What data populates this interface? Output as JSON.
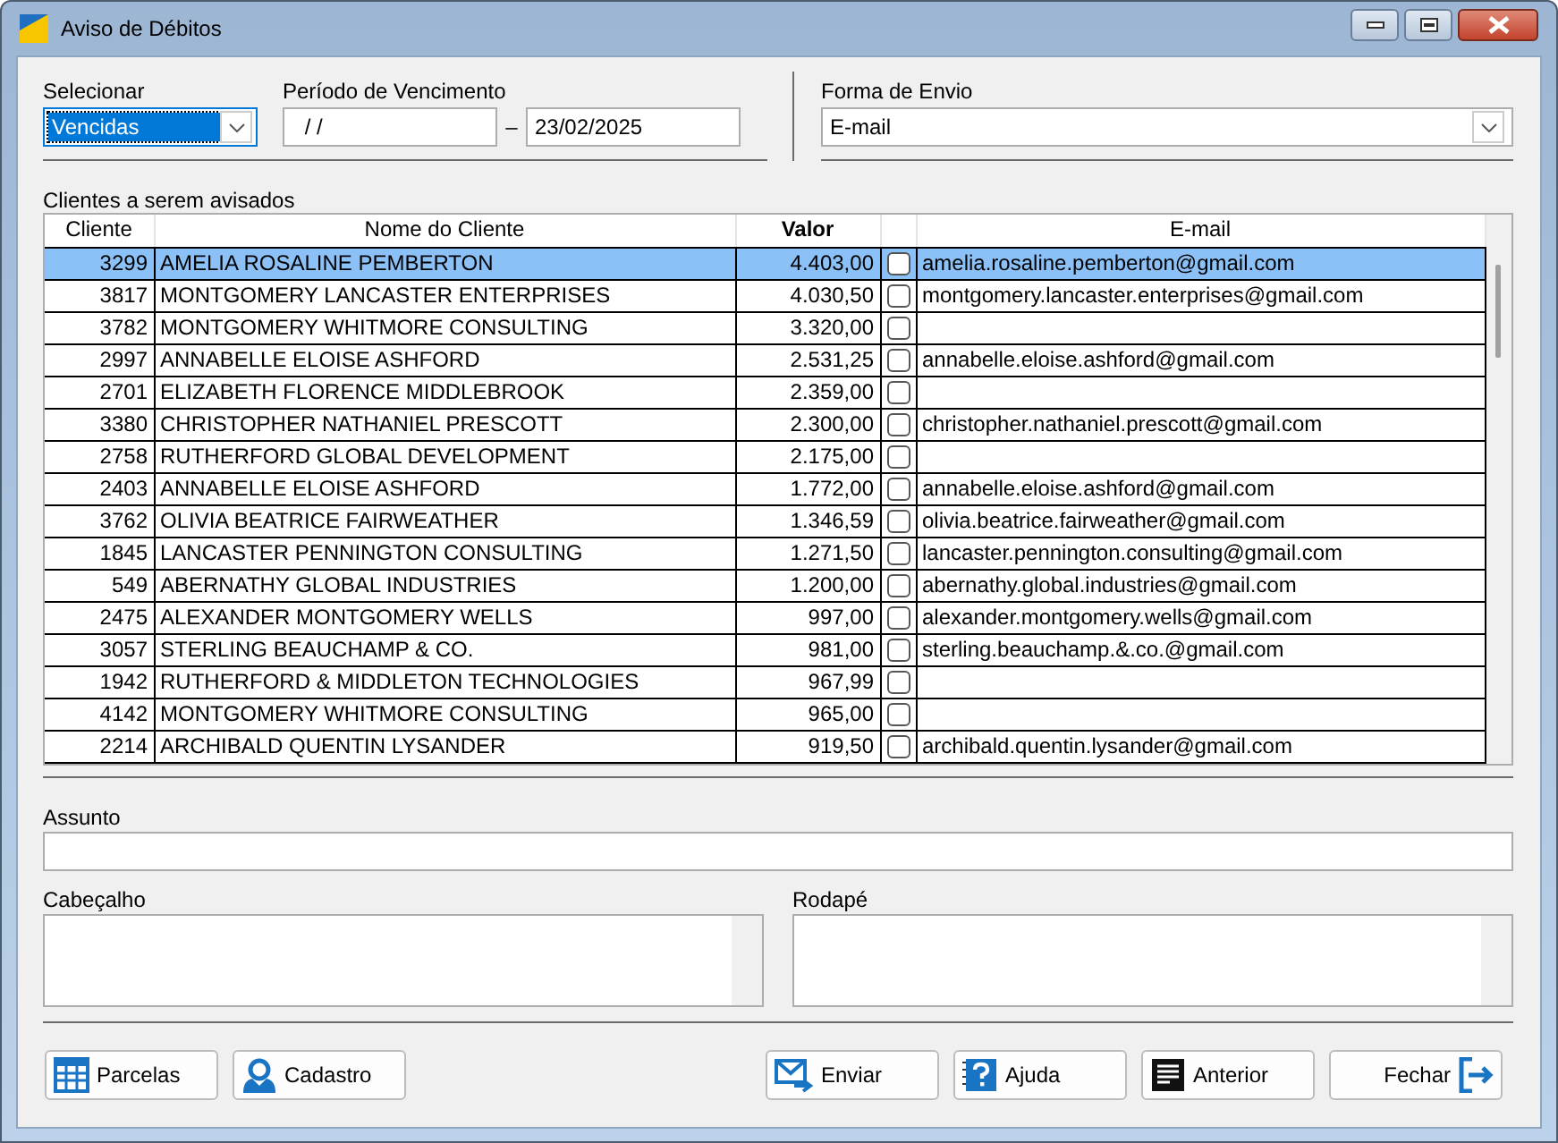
{
  "window": {
    "title": "Aviso de Débitos"
  },
  "filters": {
    "select_label": "Selecionar",
    "select_value": "Vencidas",
    "period_label": "Período de Vencimento",
    "period_from": " / /",
    "period_dash": "–",
    "period_to": "23/02/2025",
    "send_label": "Forma de Envio",
    "send_value": "E-mail"
  },
  "table": {
    "title": "Clientes a serem avisados",
    "columns": [
      "Cliente",
      "Nome do Cliente",
      "Valor",
      "E-mail"
    ],
    "rows": [
      {
        "cliente": "3299",
        "nome": "AMELIA ROSALINE PEMBERTON",
        "valor": "4.403,00",
        "checked": false,
        "email": "amelia.rosaline.pemberton@gmail.com",
        "selected": true
      },
      {
        "cliente": "3817",
        "nome": "MONTGOMERY LANCASTER ENTERPRISES",
        "valor": "4.030,50",
        "checked": false,
        "email": "montgomery.lancaster.enterprises@gmail.com",
        "selected": false
      },
      {
        "cliente": "3782",
        "nome": "MONTGOMERY WHITMORE CONSULTING",
        "valor": "3.320,00",
        "checked": false,
        "selected": false
      },
      {
        "cliente": "2997",
        "nome": "ANNABELLE ELOISE ASHFORD",
        "valor": "2.531,25",
        "checked": false,
        "email": "annabelle.eloise.ashford@gmail.com",
        "selected": false
      },
      {
        "cliente": "2701",
        "nome": "ELIZABETH FLORENCE MIDDLEBROOK",
        "valor": "2.359,00",
        "checked": false,
        "selected": false
      },
      {
        "cliente": "3380",
        "nome": "CHRISTOPHER NATHANIEL PRESCOTT",
        "valor": "2.300,00",
        "checked": false,
        "email": "christopher.nathaniel.prescott@gmail.com",
        "selected": false
      },
      {
        "cliente": "2758",
        "nome": "RUTHERFORD GLOBAL DEVELOPMENT",
        "valor": "2.175,00",
        "checked": false,
        "selected": false
      },
      {
        "cliente": "2403",
        "nome": "ANNABELLE ELOISE ASHFORD",
        "valor": "1.772,00",
        "checked": false,
        "email": "annabelle.eloise.ashford@gmail.com",
        "selected": false
      },
      {
        "cliente": "3762",
        "nome": "OLIVIA BEATRICE FAIRWEATHER",
        "valor": "1.346,59",
        "checked": false,
        "email": "olivia.beatrice.fairweather@gmail.com",
        "selected": false
      },
      {
        "cliente": "1845",
        "nome": "LANCASTER PENNINGTON CONSULTING",
        "valor": "1.271,50",
        "checked": false,
        "email": "lancaster.pennington.consulting@gmail.com",
        "selected": false
      },
      {
        "cliente": "549",
        "nome": "ABERNATHY GLOBAL INDUSTRIES",
        "valor": "1.200,00",
        "checked": false,
        "email": "abernathy.global.industries@gmail.com",
        "selected": false
      },
      {
        "cliente": "2475",
        "nome": "ALEXANDER MONTGOMERY WELLS",
        "valor": "997,00",
        "checked": false,
        "email": "alexander.montgomery.wells@gmail.com",
        "selected": false
      },
      {
        "cliente": "3057",
        "nome": "STERLING BEAUCHAMP & CO.",
        "valor": "981,00",
        "checked": false,
        "email": "sterling.beauchamp.&.co.@gmail.com",
        "selected": false
      },
      {
        "cliente": "1942",
        "nome": "RUTHERFORD & MIDDLETON TECHNOLOGIES",
        "valor": "967,99",
        "checked": false,
        "selected": false
      },
      {
        "cliente": "4142",
        "nome": "MONTGOMERY WHITMORE CONSULTING",
        "valor": "965,00",
        "checked": false,
        "selected": false
      },
      {
        "cliente": "2214",
        "nome": "ARCHIBALD QUENTIN LYSANDER",
        "valor": "919,50",
        "checked": false,
        "email": "archibald.quentin.lysander@gmail.com",
        "selected": false
      }
    ]
  },
  "message": {
    "subject_label": "Assunto",
    "header_label": "Cabeçalho",
    "footer_label": "Rodapé"
  },
  "buttons": [
    {
      "label": "Parcelas",
      "kind": "table"
    },
    {
      "label": "Cadastro",
      "kind": "person"
    },
    {
      "label": "Enviar",
      "kind": "mail"
    },
    {
      "label": "Ajuda",
      "kind": "help"
    },
    {
      "label": "Anterior",
      "kind": "doc"
    },
    {
      "label": "Fechar",
      "kind": "exit"
    }
  ]
}
